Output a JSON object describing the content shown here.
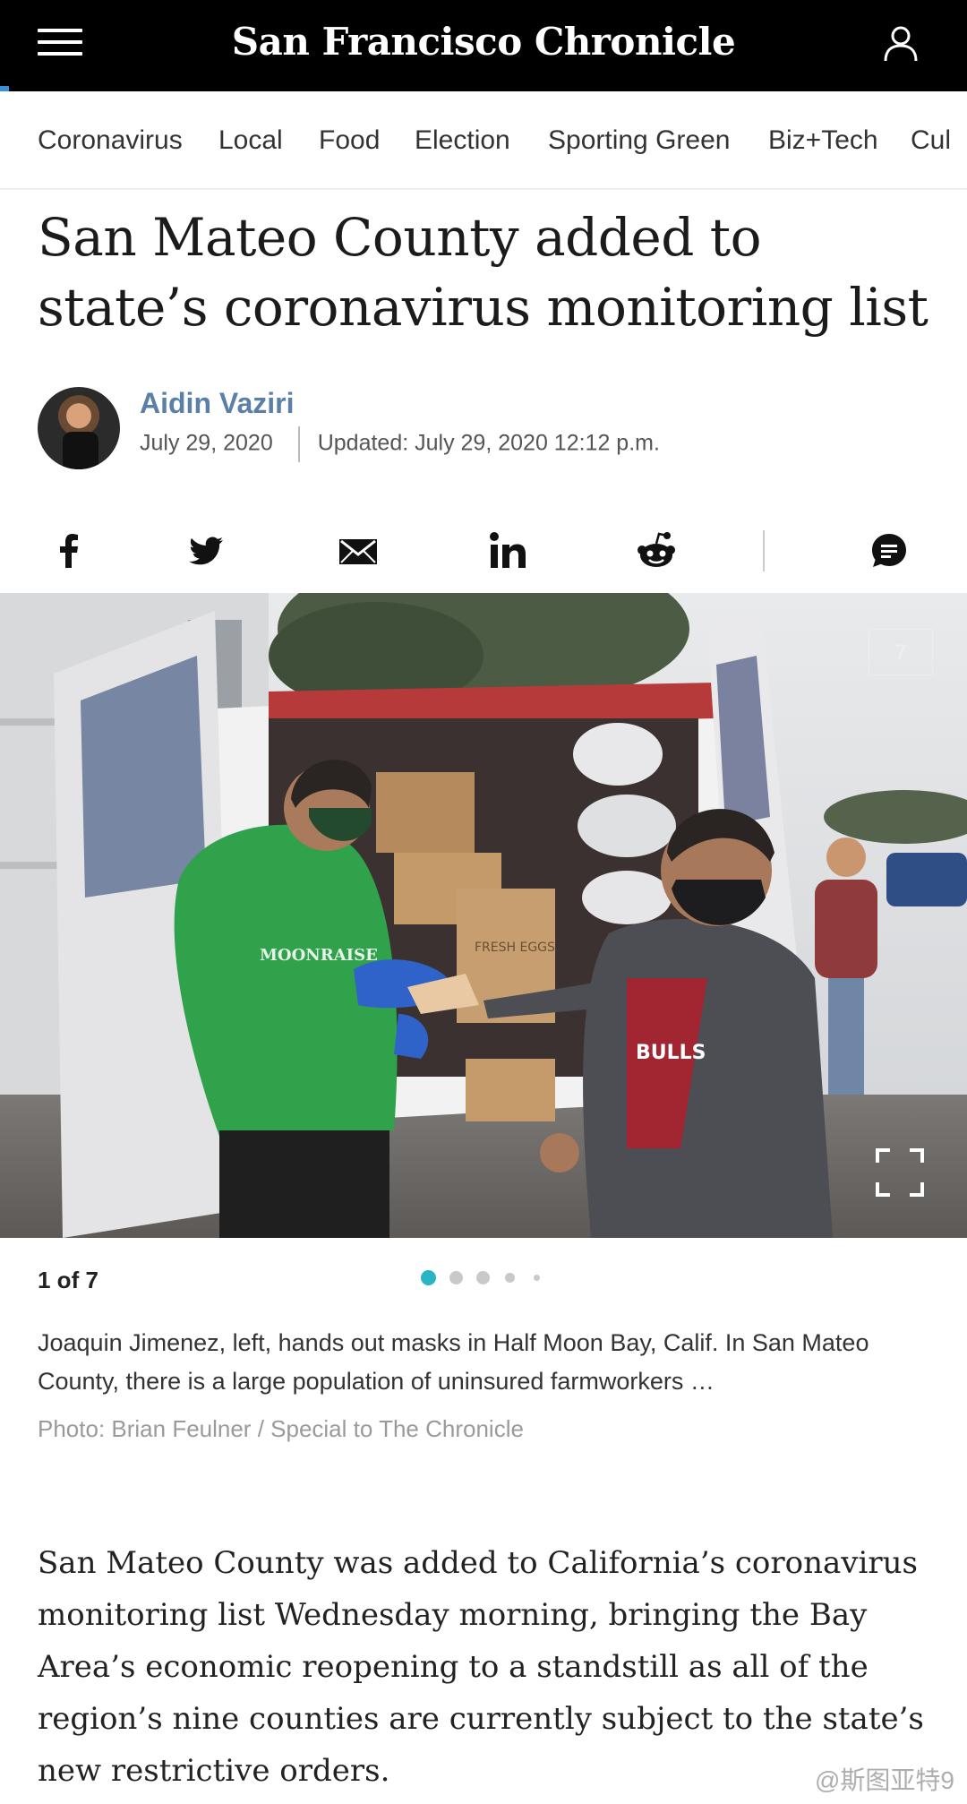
{
  "header": {
    "logo": "San Francisco Chronicle",
    "menu_icon": "hamburger-menu-icon",
    "user_icon": "user-icon"
  },
  "nav": {
    "items": [
      "Coronavirus",
      "Local",
      "Food",
      "Election",
      "Sporting Green",
      "Biz+Tech",
      "Cul"
    ]
  },
  "article": {
    "headline": "San Mateo County added to state’s coronavirus monitoring list",
    "author": "Aidin Vaziri",
    "date": "July 29, 2020",
    "updated": "Updated: July 29, 2020 12:12 p.m."
  },
  "share": {
    "icons": [
      "facebook-icon",
      "twitter-icon",
      "email-icon",
      "linkedin-icon",
      "reddit-icon",
      "comments-icon"
    ]
  },
  "gallery": {
    "counter": "1 of 7",
    "ghost_count": "7",
    "caption": "Joaquin Jimenez, left, hands out masks in Half Moon Bay, Calif. In San Mateo County, there is a large population of uninsured farmworkers …",
    "credit": "Photo: Brian Feulner / Special to The Chronicle",
    "accent_color": "#2bb3c6",
    "image_text": {
      "sweatshirt": "MOONRAISE",
      "box": "FRESH EGGS",
      "shirt": "BULLS"
    }
  },
  "body": {
    "paragraph": "San Mateo County was added to California’s coronavirus monitoring list Wednesday morning, bringing the Bay Area’s economic reopening to a standstill as all of the region’s nine counties are currently subject to the state’s new restrictive orders."
  },
  "watermark": "@斯图亚特9"
}
